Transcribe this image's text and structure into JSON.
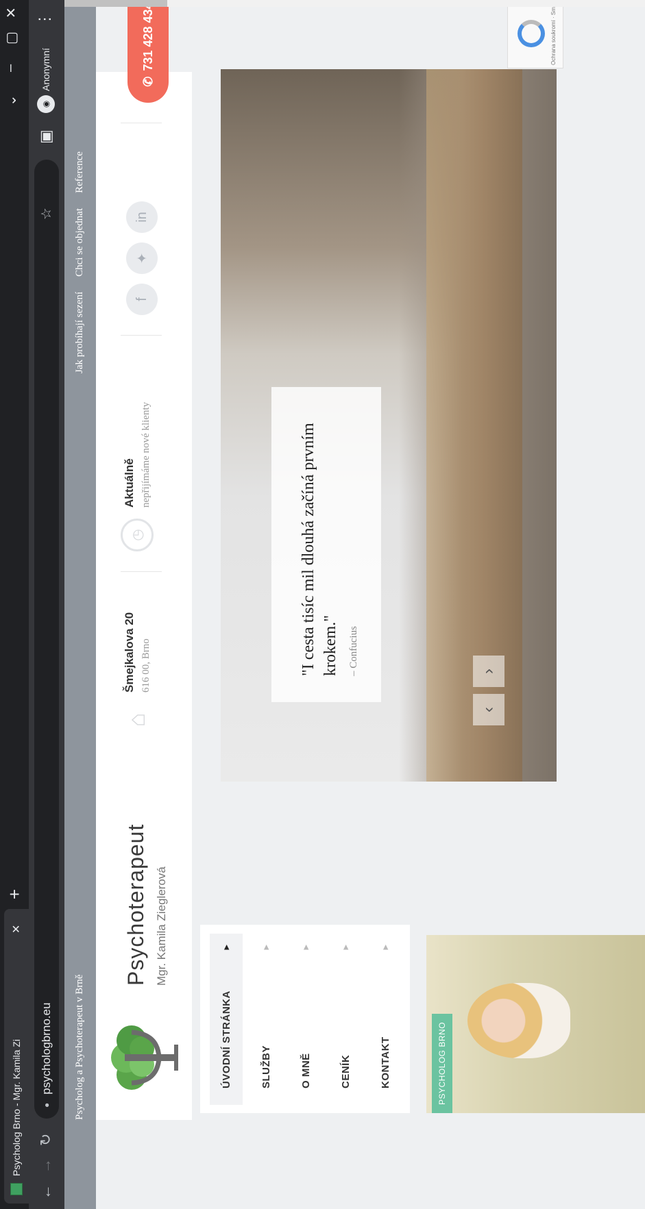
{
  "browser": {
    "tab_title": "Psycholog Brno - Mgr. Kamila Zi",
    "new_tab": "+",
    "url": "psychologbrno.eu",
    "incognito_label": "Anonymní"
  },
  "site": {
    "top_left": "Psycholog a Psychoterapeut v Brně",
    "top_links": [
      "Jak probíhají sezení",
      "Chci se objednat",
      "Reference"
    ],
    "brand_title": "Psychoterapeut",
    "brand_sub": "Mgr. Kamila Zieglerová",
    "address_title": "Šmejkalova 20",
    "address_sub": "616 00, Brno",
    "status_title": "Aktuálně",
    "status_sub": "nepřijímáme nové klienty",
    "social_icons": [
      "facebook-icon",
      "twitter-icon",
      "linkedin-icon"
    ],
    "phone": "731 428 434",
    "nav": [
      "ÚVODNÍ STRÁNKA",
      "SLUŽBY",
      "O MNĚ",
      "CENÍK",
      "KONTAKT"
    ],
    "photo_badge": "PSYCHOLOG BRNO",
    "quote": "\"I cesta tisíc mil dlouhá začíná prvním krokem.\"",
    "quote_author": "– Confucius",
    "recaptcha_text": "Ochrana soukromí · Smluvní podmínky"
  }
}
